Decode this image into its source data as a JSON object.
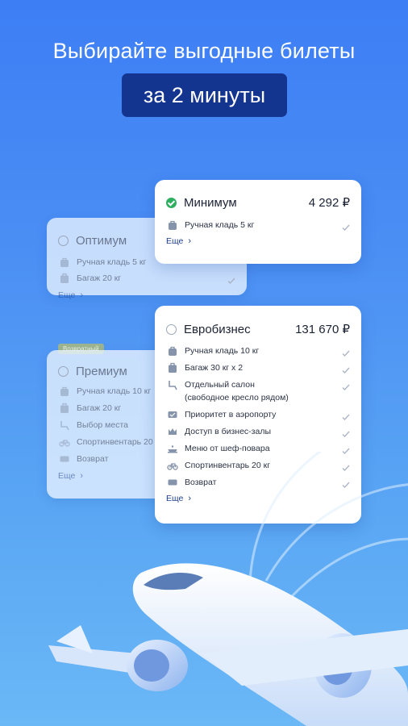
{
  "headline": "Выбирайте выгодные билеты",
  "badge": "за 2 минуты",
  "cards": {
    "minimum": {
      "title": "Минимум",
      "price": "4 292 ₽",
      "features": [
        "Ручная кладь 5 кг"
      ],
      "more": "Еще"
    },
    "optimum": {
      "title": "Оптимум",
      "features": [
        "Ручная кладь 5 кг",
        "Багаж 20 кг"
      ],
      "more": "Еще"
    },
    "premium": {
      "tag": "Возвратный",
      "title": "Премиум",
      "features": [
        "Ручная кладь 10 кг",
        "Багаж 20 кг",
        "Выбор места",
        "Спортинвентарь 20",
        "Возврат"
      ],
      "more": "Еще"
    },
    "eurobusiness": {
      "title": "Евробизнес",
      "price": "131 670 ₽",
      "features": [
        "Ручная кладь 10 кг",
        "Багаж 30 кг x 2",
        "Отдельный салон",
        "(свободное кресло рядом)",
        "Приоритет в аэропорту",
        "Доступ в бизнес-залы",
        "Меню от шеф-повара",
        "Спортинвентарь 20 кг",
        "Возврат"
      ],
      "more": "Еще"
    }
  },
  "colors": {
    "accent": "#14358f",
    "selected": "#2eae5f",
    "link": "#1d3f8c"
  },
  "icons": [
    "bag-icon",
    "luggage-icon",
    "seat-icon",
    "priority-icon",
    "lounge-icon",
    "chef-icon",
    "bicycle-icon",
    "refund-icon",
    "check-icon",
    "chevron-right-icon"
  ]
}
